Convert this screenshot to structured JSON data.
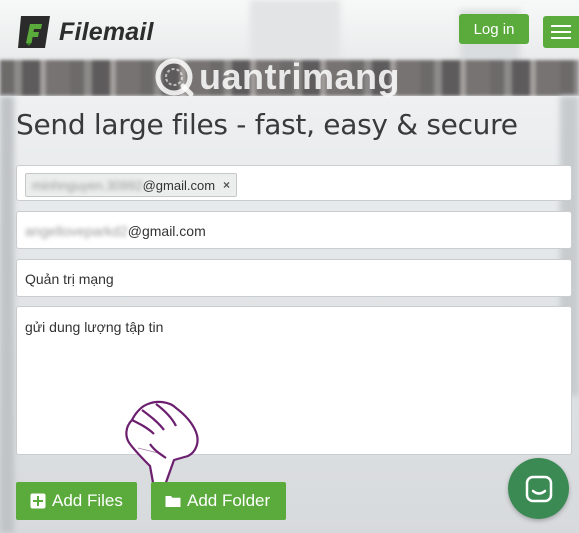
{
  "header": {
    "logo_text": "Filemail",
    "login_label": "Log in",
    "menu_icon": "hamburger-icon"
  },
  "watermark": {
    "text": "uantrimang"
  },
  "page": {
    "headline": "Send large files - fast, easy & secure"
  },
  "form": {
    "to": {
      "chip_blurred": "minhnguyen.30992",
      "chip_domain": "@gmail.com",
      "chip_remove": "×"
    },
    "from": {
      "value_blurred": "angelloveparkd2",
      "value_domain": "@gmail.com"
    },
    "subject": {
      "value": "Quản trị mạng"
    },
    "message": {
      "value": "gửi dung lượng tập tin"
    }
  },
  "actions": {
    "add_files_label": "Add Files",
    "add_folder_label": "Add Folder"
  },
  "colors": {
    "accent": "#5aaa3c",
    "chat": "#3b8a53",
    "headline": "#3a3a3a"
  }
}
